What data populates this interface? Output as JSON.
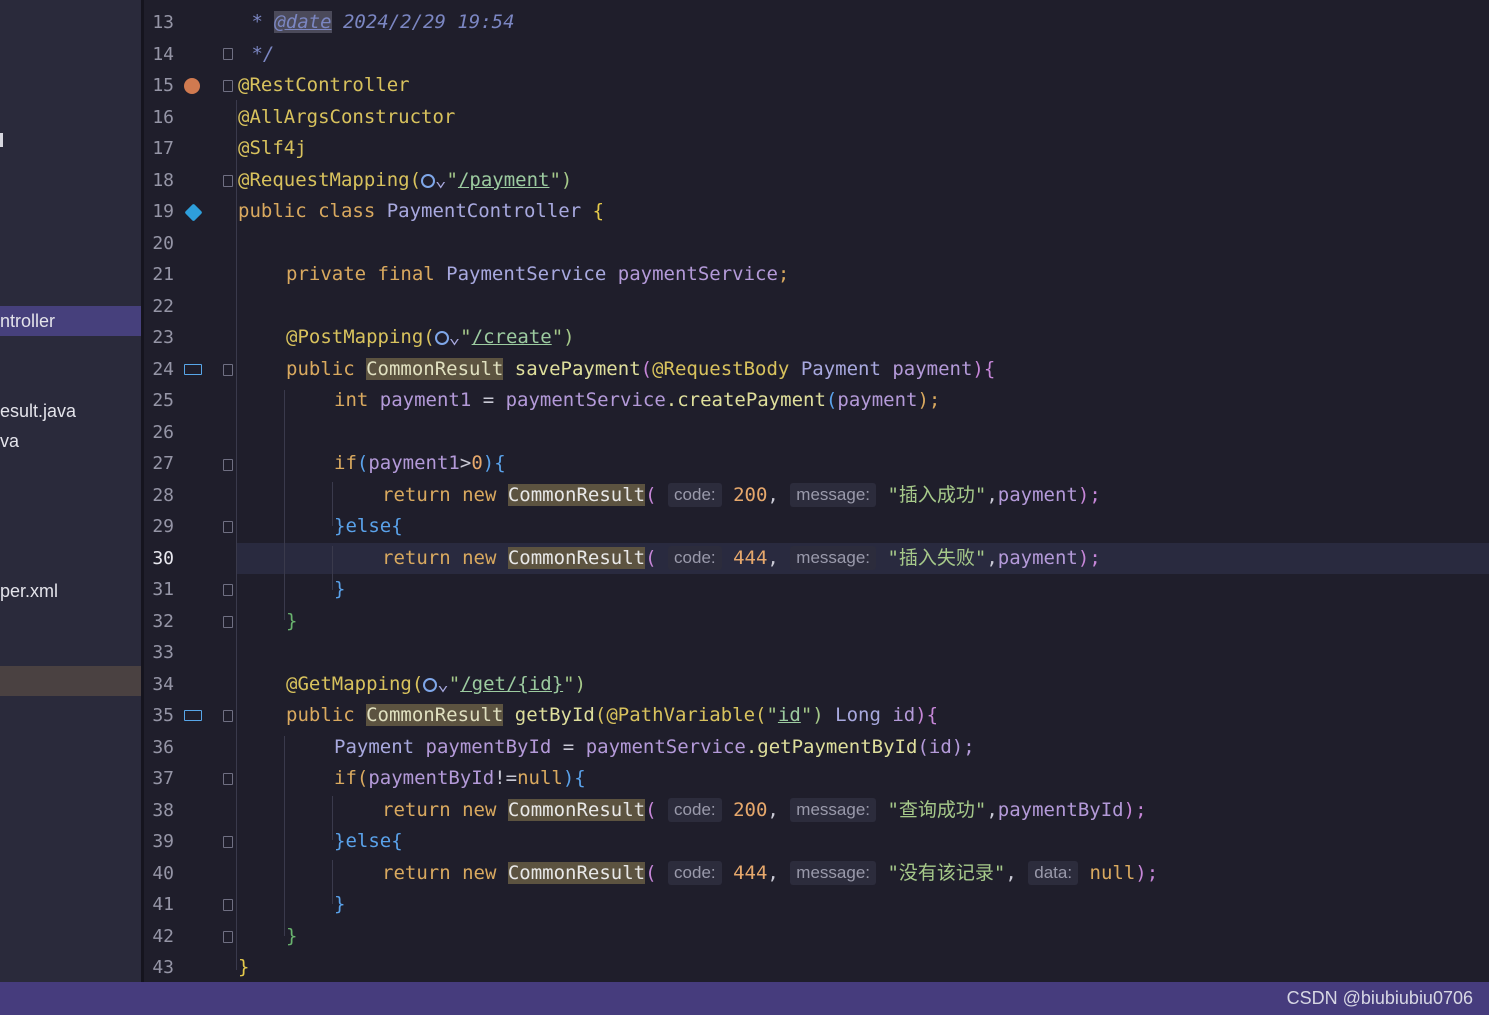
{
  "sidebar": {
    "items": [
      {
        "label": "ntroller",
        "state": "selected"
      },
      {
        "label": "esult.java",
        "state": "normal"
      },
      {
        "label": "va",
        "state": "normal"
      },
      {
        "label": "per.xml",
        "state": "normal"
      },
      {
        "label": "",
        "state": "hover"
      }
    ]
  },
  "editor": {
    "current_line": 30,
    "lines": [
      {
        "n": "13"
      },
      {
        "n": "14"
      },
      {
        "n": "15"
      },
      {
        "n": "16"
      },
      {
        "n": "17"
      },
      {
        "n": "18"
      },
      {
        "n": "19"
      },
      {
        "n": "20"
      },
      {
        "n": "21"
      },
      {
        "n": "22"
      },
      {
        "n": "23"
      },
      {
        "n": "24"
      },
      {
        "n": "25"
      },
      {
        "n": "26"
      },
      {
        "n": "27"
      },
      {
        "n": "28"
      },
      {
        "n": "29"
      },
      {
        "n": "30"
      },
      {
        "n": "31"
      },
      {
        "n": "32"
      },
      {
        "n": "33"
      },
      {
        "n": "34"
      },
      {
        "n": "35"
      },
      {
        "n": "36"
      },
      {
        "n": "37"
      },
      {
        "n": "38"
      },
      {
        "n": "39"
      },
      {
        "n": "40"
      },
      {
        "n": "41"
      },
      {
        "n": "42"
      },
      {
        "n": "43"
      }
    ],
    "code": {
      "l13_star": " * ",
      "l13_tag": "@date",
      "l13_date": " 2024/2/29 19:54",
      "l14": " */",
      "l15": "@RestController",
      "l16": "@AllArgsConstructor",
      "l17": "@Slf4j",
      "l18_ann": "@RequestMapping(",
      "l18_quote_open": "\"",
      "l18_url": "/payment",
      "l18_close": "\")",
      "l19_kw": "public class ",
      "l19_cls": "PaymentController ",
      "l19_brace": "{",
      "l21_kw": "private final ",
      "l21_cls": "PaymentService ",
      "l21_fld": "paymentService",
      "l21_semi": ";",
      "l23_ann": "@PostMapping(",
      "l23_quote_open": "\"",
      "l23_url": "/create",
      "l23_close": "\")",
      "l24_kw": "public ",
      "l24_type": "CommonResult",
      "l24_fn": " savePayment",
      "l24_paren": "(",
      "l24_ann": "@RequestBody ",
      "l24_cls": "Payment ",
      "l24_param": "payment",
      "l24_end": "){",
      "l25_kw": "int ",
      "l25_var": "payment1",
      "l25_eq": " = ",
      "l25_fld": "paymentService",
      "l25_call": ".createPayment",
      "l25_p1": "(",
      "l25_arg": "payment",
      "l25_p2": ");",
      "l27_kw": "if",
      "l27_p": "(",
      "l27_var": "payment1",
      "l27_op": ">",
      "l27_num": "0",
      "l27_end": "){",
      "ret_kw": "return new ",
      "ret_type": "CommonResult",
      "ret_paren": "(",
      "hint_code": "code:",
      "hint_message": "message:",
      "hint_data": "data:",
      "l28_code": "200",
      "l28_msg": "\"插入成功\"",
      "l28_arg": "payment",
      "l29": "}else{",
      "l30_code": "444",
      "l30_msg": "\"插入失败\"",
      "l30_arg": "payment",
      "close_brace": "}",
      "l34_ann": "@GetMapping(",
      "l34_quote_open": "\"",
      "l34_url": "/get/{id}",
      "l34_close": "\")",
      "l35_kw": "public ",
      "l35_type": "CommonResult",
      "l35_fn": " getById",
      "l35_ann": "(@PathVariable(",
      "l35_str_open": "\"",
      "l35_str": "id",
      "l35_str_close": "\") ",
      "l35_cls": "Long ",
      "l35_param": "id",
      "l35_end": "){",
      "l36_cls": "Payment ",
      "l36_var": "paymentById",
      "l36_eq": " = ",
      "l36_fld": "paymentService",
      "l36_call": ".getPaymentById",
      "l36_arg": "(id);",
      "l37": "if(",
      "l37_var": "paymentById",
      "l37_op": "!=",
      "l37_null": "null",
      "l37_end": "){",
      "l38_code": "200",
      "l38_msg": "\"查询成功\"",
      "l38_arg": "paymentById",
      "l40_code": "444",
      "l40_msg": "\"没有该记录\"",
      "l40_null": "null",
      "comma": ", ",
      "comma_tight": ",",
      "end": ");",
      "chevron": "⌄"
    }
  },
  "watermark": "CSDN @biubiubiu0706",
  "colors": {
    "background": "#1f1e2b",
    "sidebar": "#2a2a3b",
    "selection": "#46407c",
    "statusbar": "#463c7d",
    "current_line": "#292a3f"
  }
}
